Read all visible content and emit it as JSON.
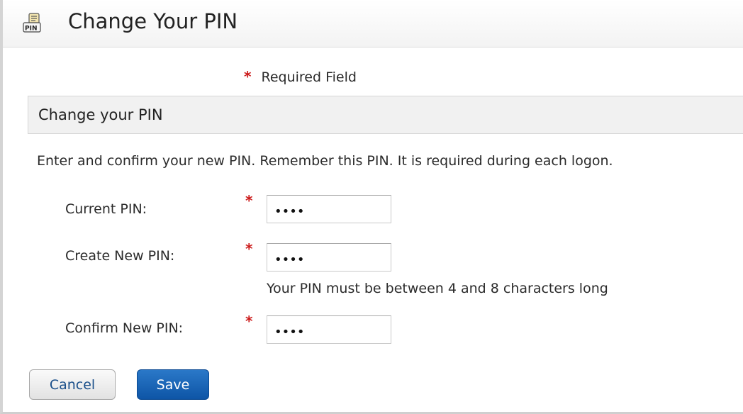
{
  "header": {
    "icon": "pin-pad-icon",
    "icon_text": "PIN",
    "title": "Change Your PIN"
  },
  "required_note": {
    "marker": "*",
    "text": "Required Field"
  },
  "section": {
    "title": "Change your PIN",
    "instructions": "Enter and confirm your new PIN. Remember this PIN. It is required during each logon."
  },
  "fields": [
    {
      "label": "Current PIN:",
      "required_marker": "*",
      "value": "••••"
    },
    {
      "label": "Create New PIN:",
      "required_marker": "*",
      "value": "••••",
      "helper": "Your PIN must be between 4 and 8 characters long"
    },
    {
      "label": "Confirm New PIN:",
      "required_marker": "*",
      "value": "••••"
    }
  ],
  "buttons": {
    "cancel_label": "Cancel",
    "save_label": "Save"
  },
  "colors": {
    "required": "#cc1a1a",
    "primary_button": "#1466b8",
    "link_text": "#1a4f8a"
  }
}
